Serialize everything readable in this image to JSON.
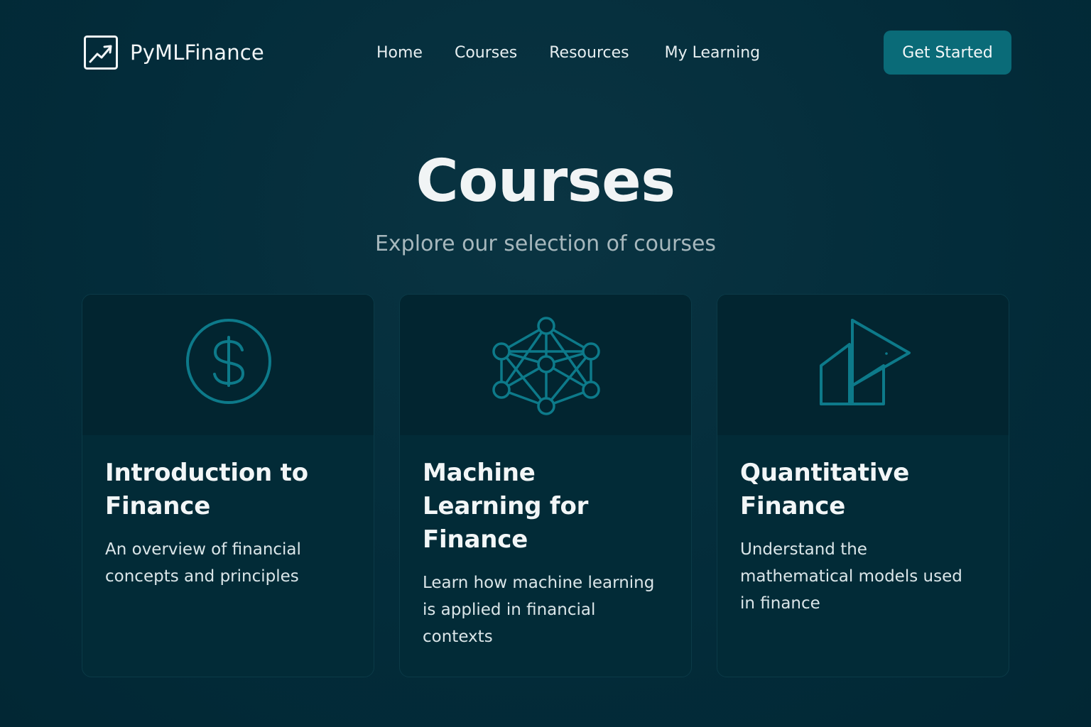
{
  "brand": {
    "name": "PyMLFinance",
    "logo_icon": "trend-chart-icon"
  },
  "nav": {
    "links": [
      {
        "label": "Home"
      },
      {
        "label": "Courses"
      },
      {
        "label": "Resources"
      },
      {
        "label": "My Learning"
      }
    ],
    "cta_label": "Get Started"
  },
  "hero": {
    "title": "Courses",
    "subtitle": "Explore our selection of courses"
  },
  "courses": [
    {
      "title": "Introduction to Finance",
      "description": "An overview of financial concepts and principles",
      "icon": "dollar-circle-icon"
    },
    {
      "title": "Machine Learning for Finance",
      "description": "Learn how machine learning is applied in financial contexts",
      "icon": "neural-network-icon"
    },
    {
      "title": "Quantitative Finance",
      "description": "Understand the mathematical models used in finance",
      "icon": "geometric-shapes-icon"
    }
  ],
  "colors": {
    "background": "#032c3a",
    "accent": "#0a6b78",
    "icon_stroke": "#0d7a8a",
    "card_background": "#022b37"
  }
}
